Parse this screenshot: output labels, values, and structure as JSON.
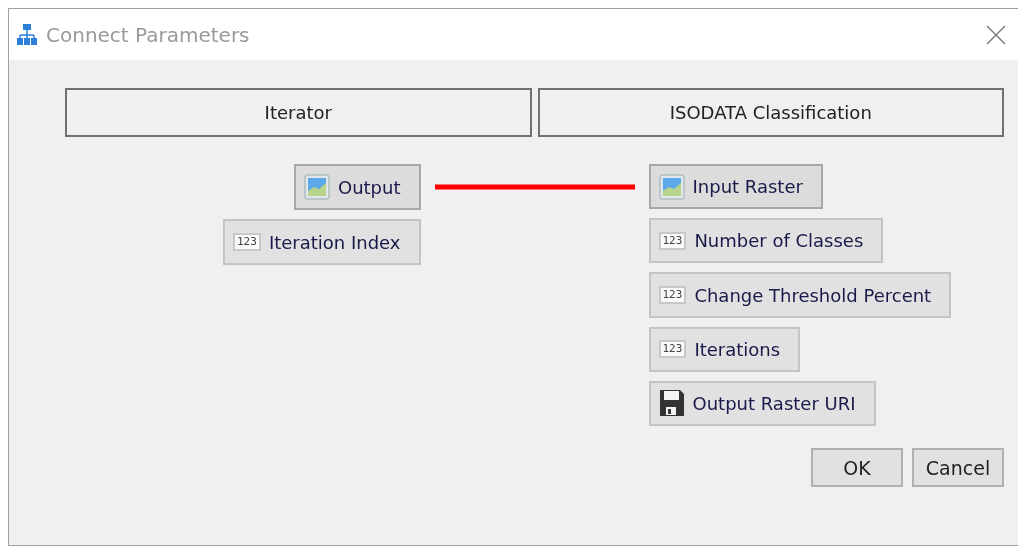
{
  "window": {
    "title": "Connect Parameters"
  },
  "source": {
    "title": "Iterator",
    "params": [
      {
        "kind": "raster",
        "label": "Output",
        "connected": true
      },
      {
        "kind": "number",
        "badge": "123",
        "label": "Iteration Index",
        "connected": false
      }
    ]
  },
  "target": {
    "title": "ISODATA Classification",
    "params": [
      {
        "kind": "raster",
        "label": "Input Raster",
        "connected": true
      },
      {
        "kind": "number",
        "badge": "123",
        "label": "Number of Classes",
        "connected": false
      },
      {
        "kind": "number",
        "badge": "123",
        "label": "Change Threshold Percent",
        "connected": false
      },
      {
        "kind": "number",
        "badge": "123",
        "label": "Iterations",
        "connected": false
      },
      {
        "kind": "file",
        "label": "Output Raster URI",
        "connected": false
      }
    ]
  },
  "buttons": [
    "OK",
    "Cancel"
  ]
}
